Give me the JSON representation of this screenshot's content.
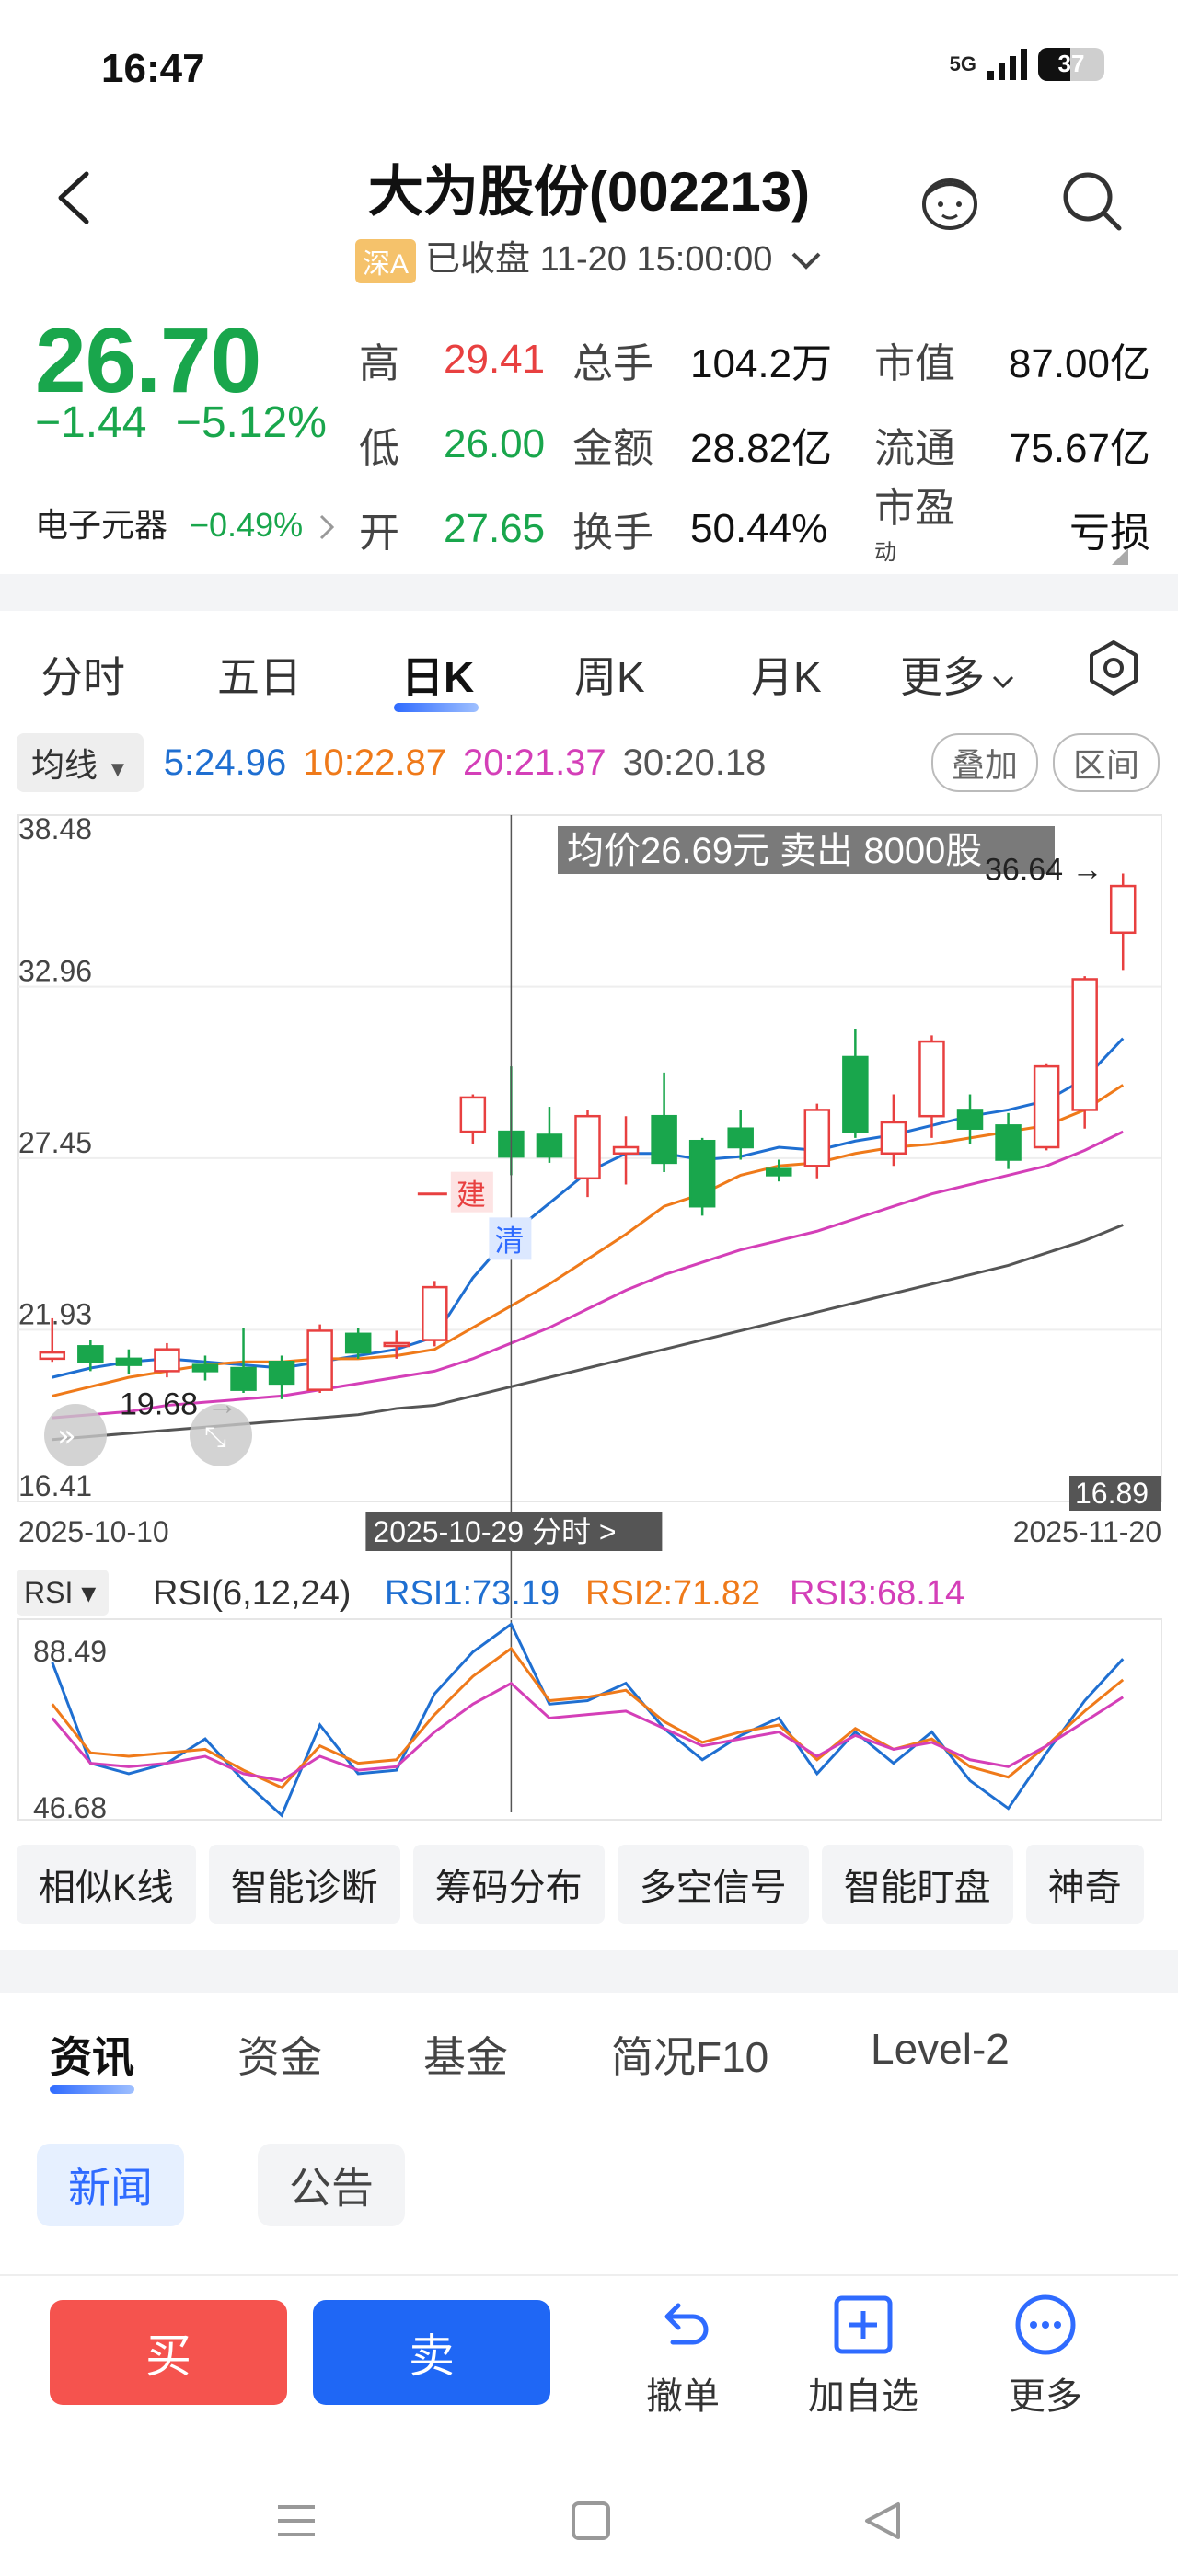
{
  "status": {
    "time": "16:47",
    "network": "5G",
    "battery": "37"
  },
  "header": {
    "title": "大为股份(002213)",
    "market_badge": "深A",
    "status_text": "已收盘 11-20 15:00:00"
  },
  "quote": {
    "price": "26.70",
    "change": "−1.44",
    "change_pct": "−5.12%",
    "sector_name": "电子元器",
    "sector_pct": "−0.49%",
    "stats": [
      [
        {
          "k": "高",
          "v": "29.41",
          "c": "red"
        },
        {
          "k": "总手",
          "v": "104.2万",
          "c": ""
        },
        {
          "k": "市值",
          "v": "87.00亿",
          "c": ""
        }
      ],
      [
        {
          "k": "低",
          "v": "26.00",
          "c": "green"
        },
        {
          "k": "金额",
          "v": "28.82亿",
          "c": ""
        },
        {
          "k": "流通",
          "v": "75.67亿",
          "c": ""
        }
      ],
      [
        {
          "k": "开",
          "v": "27.65",
          "c": "green"
        },
        {
          "k": "换手",
          "v": "50.44%",
          "c": ""
        },
        {
          "k": "市盈",
          "v": "亏损",
          "c": ""
        }
      ]
    ],
    "pe_sup": "动"
  },
  "tabs": [
    "分时",
    "五日",
    "日K",
    "周K",
    "月K",
    "更多"
  ],
  "ma": {
    "selector": "均线",
    "ma5": "5:24.96",
    "ma10": "10:22.87",
    "ma20": "20:21.37",
    "ma30": "30:20.18",
    "overlay": "叠加",
    "range": "区间"
  },
  "chart_data": {
    "type": "candlestick",
    "ylim": [
      16.41,
      38.48
    ],
    "y_ticks": [
      "38.48",
      "32.96",
      "27.45",
      "21.93",
      "16.41"
    ],
    "x_start": "2025-10-10",
    "x_end": "2025-11-20",
    "crosshair_date": "2025-10-29 分时 >",
    "tooltip": "均价26.69元 卖出 8000股",
    "high_label": "36.64",
    "low_label": "19.68",
    "min_label": "16.89",
    "marks": {
      "build": "建",
      "clear": "清"
    },
    "candles": [
      {
        "o": 21.0,
        "c": 21.2,
        "h": 22.3,
        "l": 20.9
      },
      {
        "o": 21.4,
        "c": 20.9,
        "h": 21.6,
        "l": 20.6
      },
      {
        "o": 21.0,
        "c": 20.8,
        "h": 21.3,
        "l": 20.5
      },
      {
        "o": 20.6,
        "c": 21.3,
        "h": 21.5,
        "l": 20.4
      },
      {
        "o": 20.8,
        "c": 20.6,
        "h": 21.1,
        "l": 20.3
      },
      {
        "o": 20.7,
        "c": 20.0,
        "h": 22.0,
        "l": 19.9
      },
      {
        "o": 20.9,
        "c": 20.2,
        "h": 21.1,
        "l": 19.7
      },
      {
        "o": 20.0,
        "c": 21.9,
        "h": 22.1,
        "l": 19.9
      },
      {
        "o": 21.8,
        "c": 21.2,
        "h": 22.0,
        "l": 21.0
      },
      {
        "o": 21.5,
        "c": 21.5,
        "h": 21.9,
        "l": 21.0
      },
      {
        "o": 21.6,
        "c": 23.3,
        "h": 23.5,
        "l": 21.4
      },
      {
        "o": 28.3,
        "c": 29.4,
        "h": 29.5,
        "l": 27.9
      },
      {
        "o": 28.3,
        "c": 27.5,
        "h": 30.4,
        "l": 26.9
      },
      {
        "o": 28.2,
        "c": 27.5,
        "h": 29.1,
        "l": 27.3
      },
      {
        "o": 26.8,
        "c": 28.8,
        "h": 29.0,
        "l": 26.2
      },
      {
        "o": 27.6,
        "c": 27.8,
        "h": 28.8,
        "l": 26.6
      },
      {
        "o": 28.8,
        "c": 27.3,
        "h": 30.2,
        "l": 27.0
      },
      {
        "o": 28.0,
        "c": 25.9,
        "h": 28.1,
        "l": 25.6
      },
      {
        "o": 28.4,
        "c": 27.8,
        "h": 29.0,
        "l": 27.4
      },
      {
        "o": 27.1,
        "c": 26.9,
        "h": 27.4,
        "l": 26.7
      },
      {
        "o": 27.2,
        "c": 29.0,
        "h": 29.2,
        "l": 26.8
      },
      {
        "o": 30.7,
        "c": 28.3,
        "h": 31.6,
        "l": 28.1
      },
      {
        "o": 27.6,
        "c": 28.6,
        "h": 29.5,
        "l": 27.2
      },
      {
        "o": 28.8,
        "c": 31.2,
        "h": 31.4,
        "l": 28.1
      },
      {
        "o": 29.0,
        "c": 28.4,
        "h": 29.5,
        "l": 27.9
      },
      {
        "o": 28.5,
        "c": 27.4,
        "h": 28.9,
        "l": 27.1
      },
      {
        "o": 27.8,
        "c": 30.4,
        "h": 30.5,
        "l": 27.7
      },
      {
        "o": 29.0,
        "c": 33.2,
        "h": 33.3,
        "l": 28.4
      },
      {
        "o": 34.7,
        "c": 36.2,
        "h": 36.6,
        "l": 33.5
      }
    ],
    "ma_lines": [
      {
        "name": "MA5",
        "color": "#1f6fd1",
        "values": [
          20.4,
          20.7,
          20.9,
          21.0,
          20.9,
          20.8,
          20.7,
          20.9,
          21.1,
          21.3,
          21.7,
          23.6,
          25.0,
          26.0,
          27.0,
          27.6,
          27.6,
          27.4,
          27.5,
          27.8,
          27.7,
          28.0,
          28.2,
          28.5,
          28.8,
          29.0,
          29.3,
          30.0,
          31.3
        ]
      },
      {
        "name": "MA10",
        "color": "#ef7a1a",
        "values": [
          19.8,
          20.1,
          20.4,
          20.6,
          20.8,
          20.9,
          20.9,
          21.0,
          21.0,
          21.1,
          21.3,
          22.0,
          22.7,
          23.4,
          24.2,
          25.0,
          25.9,
          26.3,
          26.9,
          27.2,
          27.3,
          27.6,
          27.8,
          27.9,
          28.1,
          28.3,
          28.5,
          29.0,
          29.8
        ]
      },
      {
        "name": "MA20",
        "color": "#d43fb8",
        "values": [
          19.1,
          19.2,
          19.3,
          19.5,
          19.6,
          19.7,
          19.8,
          20.0,
          20.2,
          20.4,
          20.6,
          21.0,
          21.5,
          22.0,
          22.6,
          23.2,
          23.7,
          24.1,
          24.5,
          24.8,
          25.1,
          25.5,
          25.9,
          26.3,
          26.6,
          26.9,
          27.2,
          27.7,
          28.3
        ]
      },
      {
        "name": "MA30",
        "color": "#555555",
        "values": [
          18.4,
          18.5,
          18.6,
          18.7,
          18.8,
          18.9,
          19.0,
          19.1,
          19.2,
          19.4,
          19.5,
          19.8,
          20.1,
          20.4,
          20.7,
          21.0,
          21.3,
          21.6,
          21.9,
          22.2,
          22.5,
          22.8,
          23.1,
          23.4,
          23.7,
          24.0,
          24.4,
          24.8,
          25.3
        ]
      }
    ],
    "rsi": {
      "label": "RSI",
      "params": "RSI(6,12,24)",
      "r1": "RSI1:73.19",
      "r2": "RSI2:71.82",
      "r3": "RSI3:68.14",
      "ylim": [
        46.68,
        88.49
      ],
      "y_ticks": [
        "88.49",
        "46.68"
      ],
      "series": [
        {
          "name": "RSI1",
          "color": "#1f6fd1",
          "values": [
            84,
            55,
            52,
            55,
            62,
            50,
            40,
            66,
            52,
            53,
            75,
            87,
            95,
            72,
            73,
            78,
            65,
            56,
            63,
            68,
            52,
            64,
            55,
            64,
            50,
            42,
            58,
            73,
            85
          ]
        },
        {
          "name": "RSI2",
          "color": "#ef7a1a",
          "values": [
            72,
            58,
            57,
            58,
            59,
            53,
            48,
            60,
            55,
            56,
            69,
            80,
            88,
            73,
            74,
            76,
            67,
            61,
            64,
            66,
            56,
            65,
            59,
            62,
            54,
            51,
            60,
            70,
            79
          ]
        },
        {
          "name": "RSI3",
          "color": "#d43fb8",
          "values": [
            68,
            55,
            54,
            55,
            57,
            52,
            50,
            57,
            53,
            54,
            64,
            72,
            78,
            68,
            69,
            70,
            65,
            60,
            62,
            64,
            57,
            63,
            59,
            61,
            56,
            54,
            60,
            67,
            74
          ]
        }
      ]
    }
  },
  "quick_actions": [
    "相似K线",
    "智能诊断",
    "筹码分布",
    "多空信号",
    "智能盯盘",
    "神奇"
  ],
  "news_tabs": [
    "资讯",
    "资金",
    "基金",
    "简况F10",
    "Level-2"
  ],
  "sub_tabs": [
    "新闻",
    "公告"
  ],
  "bottom": {
    "buy": "买",
    "sell": "卖",
    "cancel": "撤单",
    "add": "加自选",
    "more": "更多"
  }
}
